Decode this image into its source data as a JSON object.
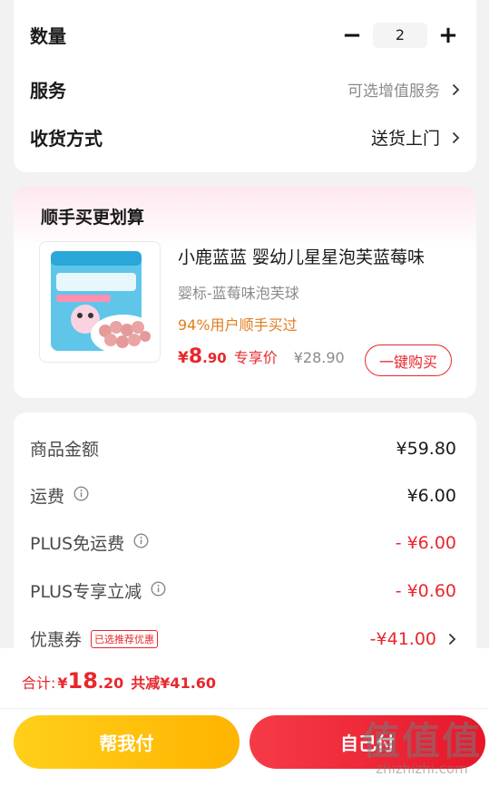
{
  "top_card": {
    "quantity_label": "数量",
    "quantity_value": "2",
    "minus_glyph": "−",
    "plus_glyph": "+",
    "service_label": "服务",
    "service_value": "可选增值服务",
    "delivery_label": "收货方式",
    "delivery_value": "送货上门"
  },
  "bundle": {
    "title": "顺手买更划算",
    "product_name": "小鹿蓝蓝 婴幼儿星星泡芙蓝莓味",
    "spec": "婴标-蓝莓味泡芙球",
    "stat": "94%用户顺手买过",
    "price_symbol": "¥",
    "price_int": "8",
    "price_dec": ".90",
    "price_tag": "专享价",
    "original_price": "¥28.90",
    "buy_label": "一键购买"
  },
  "price_detail": {
    "items": [
      {
        "label": "商品金额",
        "value": "¥59.80"
      },
      {
        "label": "运费",
        "value": "¥6.00"
      },
      {
        "label": "PLUS免运费",
        "value": "- ¥6.00"
      },
      {
        "label": "PLUS专享立减",
        "value": "- ¥0.60"
      },
      {
        "label": "优惠券",
        "tag": "已选推荐优惠",
        "value": "-¥41.00"
      }
    ]
  },
  "footer": {
    "total_label": "合计:",
    "total_symbol": "¥",
    "total_int": "18",
    "total_dec": ".20",
    "discount_text": "共减¥41.60",
    "help_pay_label": "帮我付",
    "self_pay_label": "自己付"
  },
  "watermark": {
    "big": "值值值",
    "domain": "zhizhizhi.com"
  },
  "colors": {
    "accent_red": "#e8272c",
    "orange": "#e27d1e",
    "yellow_button": "#ffc107",
    "muted": "#8a8a8a"
  }
}
